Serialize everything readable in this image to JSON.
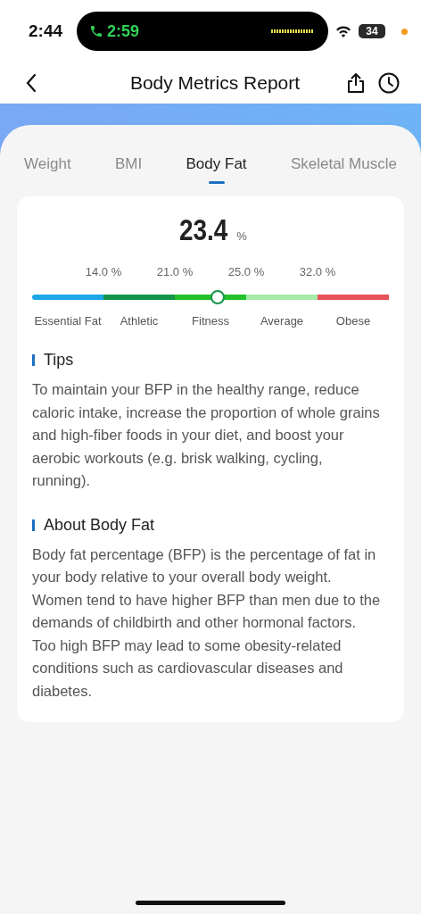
{
  "status_bar": {
    "time": "2:44",
    "call_time": "2:59",
    "battery": "34"
  },
  "nav": {
    "title": "Body Metrics Report"
  },
  "tabs": [
    {
      "label": "Weight",
      "selected": false
    },
    {
      "label": "BMI",
      "selected": false
    },
    {
      "label": "Body Fat",
      "selected": true
    },
    {
      "label": "Skeletal Muscle",
      "selected": false
    }
  ],
  "reading": {
    "value": "23.4",
    "unit": "%"
  },
  "gauge": {
    "thresholds": [
      "14.0 %",
      "21.0 %",
      "25.0 %",
      "32.0 %"
    ],
    "segments": [
      {
        "label": "Essential Fat",
        "color": "#1ea7e8"
      },
      {
        "label": "Athletic",
        "color": "#14944a"
      },
      {
        "label": "Fitness",
        "color": "#22c02a"
      },
      {
        "label": "Average",
        "color": "#a6eba8"
      },
      {
        "label": "Obese",
        "color": "#e8505b"
      }
    ]
  },
  "sections": [
    {
      "heading": "Tips",
      "text": "To maintain your BFP in the healthy range, reduce caloric intake, increase the proportion of whole grains and high-fiber foods in your diet, and boost your aerobic workouts (e.g. brisk walking, cycling, running)."
    },
    {
      "heading": "About Body Fat",
      "text": "Body fat percentage (BFP) is the percentage of fat in your body relative to your overall body weight. Women tend to have higher BFP than men due to the demands of childbirth and other hormonal factors. Too high BFP may lead to some obesity-related conditions such as cardiovascular diseases and diabetes."
    }
  ]
}
